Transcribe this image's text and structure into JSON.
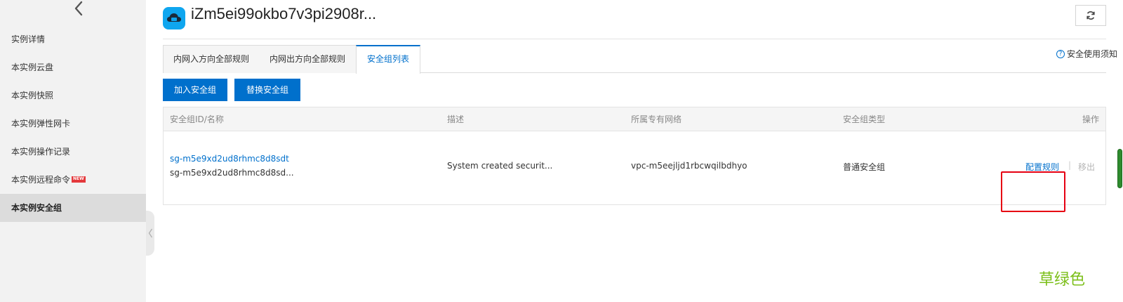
{
  "sidebar": {
    "items": [
      {
        "label": "实例详情"
      },
      {
        "label": "本实例云盘"
      },
      {
        "label": "本实例快照"
      },
      {
        "label": "本实例弹性网卡"
      },
      {
        "label": "本实例操作记录"
      },
      {
        "label": "本实例远程命令",
        "badge": "NEW"
      },
      {
        "label": "本实例安全组",
        "active": true
      }
    ]
  },
  "header": {
    "title": "iZm5ei99okbo7v3pi2908r..."
  },
  "tabs": [
    {
      "label": "内网入方向全部规则"
    },
    {
      "label": "内网出方向全部规则"
    },
    {
      "label": "安全组列表",
      "active": true
    }
  ],
  "help_link": "安全使用须知",
  "actions": {
    "add": "加入安全组",
    "replace": "替换安全组"
  },
  "table": {
    "columns": [
      "安全组ID/名称",
      "描述",
      "所属专有网络",
      "安全组类型",
      "操作"
    ],
    "rows": [
      {
        "id": "sg-m5e9xd2ud8rhmc8d8sdt",
        "name": "sg-m5e9xd2ud8rhmc8d8sd...",
        "description": "System created securit...",
        "vpc": "vpc-m5eejljd1rbcwqilbdhyo",
        "type": "普通安全组",
        "op_config": "配置规则",
        "op_remove": "移出"
      }
    ]
  },
  "annotation": "草绿色",
  "colors": {
    "primary": "#0070cc",
    "highlight_border": "#e60012",
    "annotation_green": "#7cbf1a",
    "sidebar_bg": "#f2f2f2",
    "active_item_bg": "#dcdcdc"
  }
}
